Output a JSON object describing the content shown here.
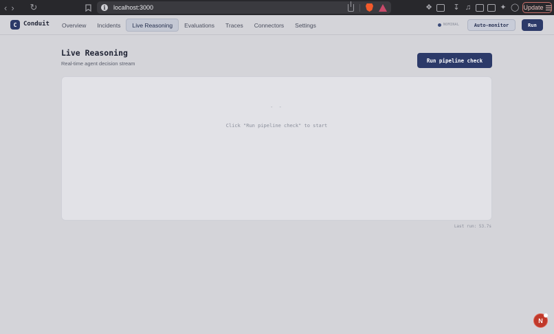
{
  "browser": {
    "url": "localhost:3000",
    "update_label": "Update",
    "icons": [
      "back-icon",
      "forward-icon",
      "reload-icon",
      "bookmark-icon",
      "info-icon",
      "share-icon",
      "brave-shield-icon",
      "rewards-icon",
      "extensions-icon",
      "screenshot-icon",
      "download-icon",
      "music-icon",
      "sidebar-icon",
      "wallet-icon",
      "leo-icon",
      "vpn-icon",
      "menu-icon"
    ]
  },
  "app": {
    "logo_letter": "C",
    "brand": "Conduit",
    "tabs": [
      {
        "label": "Overview"
      },
      {
        "label": "Incidents"
      },
      {
        "label": "Live Reasoning",
        "active": true
      },
      {
        "label": "Evaluations"
      },
      {
        "label": "Traces"
      },
      {
        "label": "Connectors"
      },
      {
        "label": "Settings"
      }
    ],
    "status": "NOMINAL",
    "auto_monitor_label": "Auto-monitor",
    "run_label": "Run"
  },
  "main": {
    "title": "Live Reasoning",
    "subtitle": "Real-time agent decision stream",
    "pipeline_button": "Run pipeline check",
    "empty_dots": "- -",
    "empty_message": "Click \"Run pipeline check\" to start",
    "last_run": "Last run: 53.7s"
  },
  "avatar_letter": "N",
  "colors": {
    "accent": "#2c3a69",
    "background": "#d4d4d9",
    "panel": "#e2e2e7",
    "avatar": "#c0392b"
  }
}
